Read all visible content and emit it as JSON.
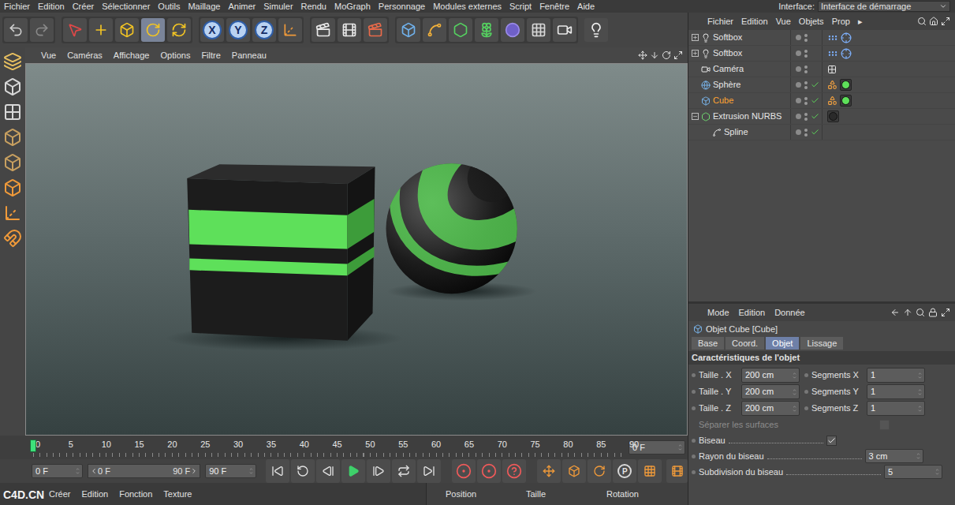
{
  "menu_bar": {
    "items": [
      "Fichier",
      "Edition",
      "Créer",
      "Sélectionner",
      "Outils",
      "Maillage",
      "Animer",
      "Simuler",
      "Rendu",
      "MoGraph",
      "Personnage",
      "Modules externes",
      "Script",
      "Fenêtre",
      "Aide"
    ],
    "interface_label": "Interface:",
    "interface_value": "Interface de démarrage"
  },
  "toolbar": {
    "tools": [
      {
        "selected": false
      },
      {
        "selected": false
      },
      {
        "selected": false
      },
      {
        "selected": true
      },
      {
        "selected": false
      }
    ],
    "axes": [
      {
        "label": "X",
        "on": true
      },
      {
        "label": "Y",
        "on": true
      },
      {
        "label": "Z",
        "on": true
      }
    ]
  },
  "viewport": {
    "menu": [
      "Vue",
      "Caméras",
      "Affichage",
      "Options",
      "Filtre",
      "Panneau"
    ]
  },
  "timeline": {
    "ticks": [
      "0",
      "5",
      "10",
      "15",
      "20",
      "25",
      "30",
      "35",
      "40",
      "45",
      "50",
      "55",
      "60",
      "65",
      "70",
      "75",
      "80",
      "85",
      "90"
    ],
    "level": 0,
    "frame": "0 F"
  },
  "transport": {
    "start": "0 F",
    "range_start": "0 F",
    "range_end": "90 F",
    "end": "90 F",
    "key_label": "P"
  },
  "object_manager": {
    "menu": [
      "Fichier",
      "Edition",
      "Vue",
      "Objets",
      "Prop",
      "▸"
    ],
    "objects": [
      {
        "name": "Softbox",
        "kind": "light",
        "depth": 0,
        "expandable": true,
        "expanded": false,
        "selected": false,
        "checked": false,
        "tags": [
          {
            "kind": "dots"
          },
          {
            "kind": "target"
          }
        ]
      },
      {
        "name": "Softbox",
        "kind": "light",
        "depth": 0,
        "expandable": true,
        "expanded": false,
        "selected": false,
        "checked": false,
        "tags": [
          {
            "kind": "dots"
          },
          {
            "kind": "target"
          }
        ]
      },
      {
        "name": "Caméra",
        "kind": "camera",
        "depth": 0,
        "expandable": false,
        "expanded": false,
        "selected": false,
        "checked": false,
        "tags": [
          {
            "kind": "protect"
          }
        ]
      },
      {
        "name": "Sphère",
        "kind": "sphere",
        "depth": 0,
        "expandable": false,
        "expanded": false,
        "selected": false,
        "checked": true,
        "tags": [
          {
            "kind": "texture"
          },
          {
            "kind": "material",
            "color": "#5ee05a"
          }
        ]
      },
      {
        "name": "Cube",
        "kind": "cube",
        "depth": 0,
        "expandable": false,
        "expanded": false,
        "selected": true,
        "checked": true,
        "tags": [
          {
            "kind": "texture"
          },
          {
            "kind": "material",
            "color": "#5ee05a"
          }
        ]
      },
      {
        "name": "Extrusion NURBS",
        "kind": "nurbs",
        "depth": 0,
        "expandable": true,
        "expanded": true,
        "selected": false,
        "checked": true,
        "tags": [
          {
            "kind": "material",
            "color": "#2a2a2a"
          }
        ]
      },
      {
        "name": "Spline",
        "kind": "spline",
        "depth": 1,
        "expandable": false,
        "expanded": false,
        "selected": false,
        "checked": true,
        "tags": []
      }
    ]
  },
  "attributes": {
    "menu": [
      "Mode",
      "Edition",
      "Donnée"
    ],
    "title": "Objet Cube [Cube]",
    "tabs": [
      {
        "label": "Base",
        "selected": false
      },
      {
        "label": "Coord.",
        "selected": false
      },
      {
        "label": "Objet",
        "selected": true
      },
      {
        "label": "Lissage",
        "selected": false
      }
    ],
    "section": "Caractéristiques de l'objet",
    "size_rows": [
      {
        "label": "Taille . X",
        "value": "200 cm",
        "segments_label": "Segments X",
        "segments_value": "1"
      },
      {
        "label": "Taille . Y",
        "value": "200 cm",
        "segments_label": "Segments Y",
        "segments_value": "1"
      },
      {
        "label": "Taille . Z",
        "value": "200 cm",
        "segments_label": "Segments Z",
        "segments_value": "1"
      }
    ],
    "options": [
      {
        "label": "Séparer les surfaces",
        "kind": "checkbox",
        "checked": false,
        "disabled": true
      },
      {
        "label": "Biseau",
        "kind": "checkbox",
        "checked": true,
        "disabled": false
      },
      {
        "label": "Rayon du biseau",
        "kind": "number",
        "value": "3 cm",
        "disabled": false
      },
      {
        "label": "Subdivision du biseau",
        "kind": "number",
        "value": "5",
        "disabled": false
      }
    ]
  },
  "material_manager": {
    "menu": [
      "Créer",
      "Edition",
      "Fonction",
      "Texture"
    ]
  },
  "coordinates": {
    "headers": [
      "Position",
      "Taille",
      "Rotation"
    ]
  },
  "watermark": "C4D.CN"
}
